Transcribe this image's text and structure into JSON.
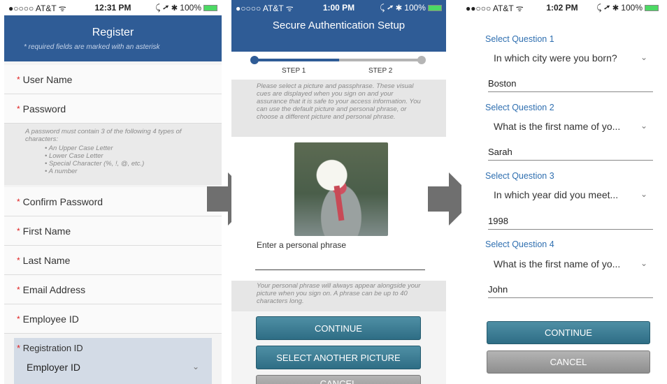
{
  "register_screen": {
    "status": {
      "carrier": "●○○○○ AT&T ᯤ",
      "time": "12:31 PM",
      "right": "⤹ ➚ ✱ 100%"
    },
    "title": "Register",
    "subtitle": "* required fields are marked with an asterisk",
    "required_marker": "*",
    "fields": {
      "user_name": "User Name",
      "password": "Password",
      "confirm_password": "Confirm Password",
      "first_name": "First Name",
      "last_name": "Last Name",
      "email": "Email Address",
      "employee_id": "Employee ID"
    },
    "password_hint": {
      "intro": "A password must contain 3 of the following 4 types of characters:",
      "rules": [
        "An Upper Case Letter",
        "Lower Case Letter",
        "Special Character (%, !, @, etc.)",
        "A number"
      ]
    },
    "registration": {
      "label": "Registration ID",
      "selected": "Employer ID"
    }
  },
  "auth_setup_screen": {
    "status": {
      "carrier": "●○○○○ AT&T ᯤ",
      "time": "1:00 PM",
      "right": "⤹ ➚ ✱ 100%"
    },
    "title": "Secure Authentication Setup",
    "steps": [
      "STEP 1",
      "STEP 2"
    ],
    "info": "Please select a picture and passphrase. These visual cues are displayed when you sign on and your assurance that it is safe to your access information. You can use the default picture and personal phrase, or choose a different picture and personal phrase.",
    "phrase_label": "Enter a personal phrase",
    "phrase_note": "Your personal phrase will always appear alongside your picture when you sign on. A phrase can be up to 40 characters long.",
    "continue_label": "CONTINUE",
    "select_picture_label": "SELECT ANOTHER PICTURE",
    "cancel_label": "CANCEL"
  },
  "security_questions_screen": {
    "status": {
      "carrier": "●●○○○ AT&T ᯤ",
      "time": "1:02 PM",
      "right": "⤹ ➚ ✱ 100%"
    },
    "questions": [
      {
        "label": "Select Question 1",
        "question": "In which city were you born?",
        "answer": "Boston"
      },
      {
        "label": "Select Question 2",
        "question": "What is the first name of yo...",
        "answer": "Sarah"
      },
      {
        "label": "Select Question 3",
        "question": "In which year did you meet...",
        "answer": "1998"
      },
      {
        "label": "Select Question 4",
        "question": "What is the first name of yo...",
        "answer": "John"
      }
    ],
    "continue_label": "CONTINUE",
    "cancel_label": "CANCEL"
  },
  "colors": {
    "header_blue": "#2f5c96",
    "button_teal": "#3c7d95",
    "question_blue": "#2f6fb0",
    "required_red": "#e02020"
  },
  "icons": [
    "chevron-down-icon",
    "arrow-right-icon",
    "battery-icon"
  ]
}
